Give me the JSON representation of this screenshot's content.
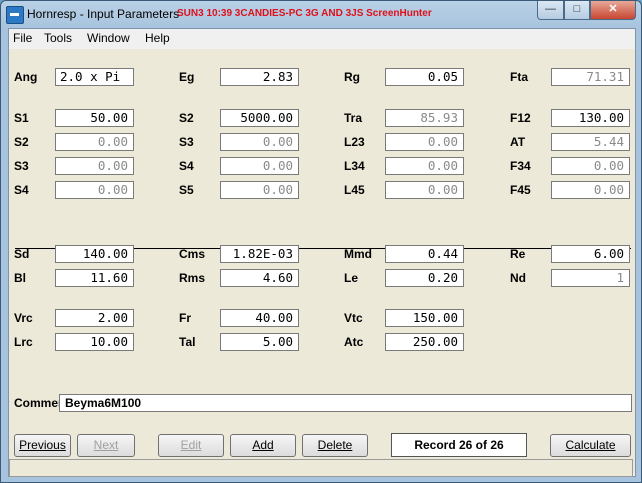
{
  "window": {
    "title": "Hornresp - Input Parameters",
    "overlay_text": "SUN3 10:39 3CANDIES-PC 3G AND 3JS ScreenHunter",
    "minimize_glyph": "—",
    "maximize_glyph": "□",
    "close_glyph": "✕"
  },
  "menu": [
    "File",
    "Tools",
    "Window",
    "Help"
  ],
  "params": {
    "ang": {
      "label": "Ang",
      "value": "2.0 x Pi"
    },
    "eg": {
      "label": "Eg",
      "value": "2.83"
    },
    "rg": {
      "label": "Rg",
      "value": "0.05"
    },
    "fta": {
      "label": "Fta",
      "value": "71.31"
    },
    "s1": {
      "label": "S1",
      "value": "50.00"
    },
    "s2a": {
      "label": "S2",
      "value": "5000.00"
    },
    "tra": {
      "label": "Tra",
      "value": "85.93"
    },
    "f12": {
      "label": "F12",
      "value": "130.00"
    },
    "s2b": {
      "label": "S2",
      "value": "0.00"
    },
    "s3a": {
      "label": "S3",
      "value": "0.00"
    },
    "l23": {
      "label": "L23",
      "value": "0.00"
    },
    "at": {
      "label": "AT",
      "value": "5.44"
    },
    "s3b": {
      "label": "S3",
      "value": "0.00"
    },
    "s4a": {
      "label": "S4",
      "value": "0.00"
    },
    "l34": {
      "label": "L34",
      "value": "0.00"
    },
    "f34": {
      "label": "F34",
      "value": "0.00"
    },
    "s4b": {
      "label": "S4",
      "value": "0.00"
    },
    "s5": {
      "label": "S5",
      "value": "0.00"
    },
    "l45": {
      "label": "L45",
      "value": "0.00"
    },
    "f45": {
      "label": "F45",
      "value": "0.00"
    },
    "sd": {
      "label": "Sd",
      "value": "140.00"
    },
    "cms": {
      "label": "Cms",
      "value": "1.82E-03"
    },
    "mmd": {
      "label": "Mmd",
      "value": "0.44"
    },
    "re": {
      "label": "Re",
      "value": "6.00"
    },
    "bl": {
      "label": "Bl",
      "value": "11.60"
    },
    "rms": {
      "label": "Rms",
      "value": "4.60"
    },
    "le": {
      "label": "Le",
      "value": "0.20"
    },
    "nd": {
      "label": "Nd",
      "value": "1"
    },
    "vrc": {
      "label": "Vrc",
      "value": "2.00"
    },
    "fr": {
      "label": "Fr",
      "value": "40.00"
    },
    "vtc": {
      "label": "Vtc",
      "value": "150.00"
    },
    "lrc": {
      "label": "Lrc",
      "value": "10.00"
    },
    "tal": {
      "label": "Tal",
      "value": "5.00"
    },
    "atc": {
      "label": "Atc",
      "value": "250.00"
    }
  },
  "comment": {
    "label": "Comment",
    "value": "Beyma6M100"
  },
  "buttons": {
    "previous": "Previous",
    "next": "Next",
    "edit": "Edit",
    "add": "Add",
    "delete": "Delete",
    "calculate": "Calculate"
  },
  "record": "Record 26 of 26"
}
